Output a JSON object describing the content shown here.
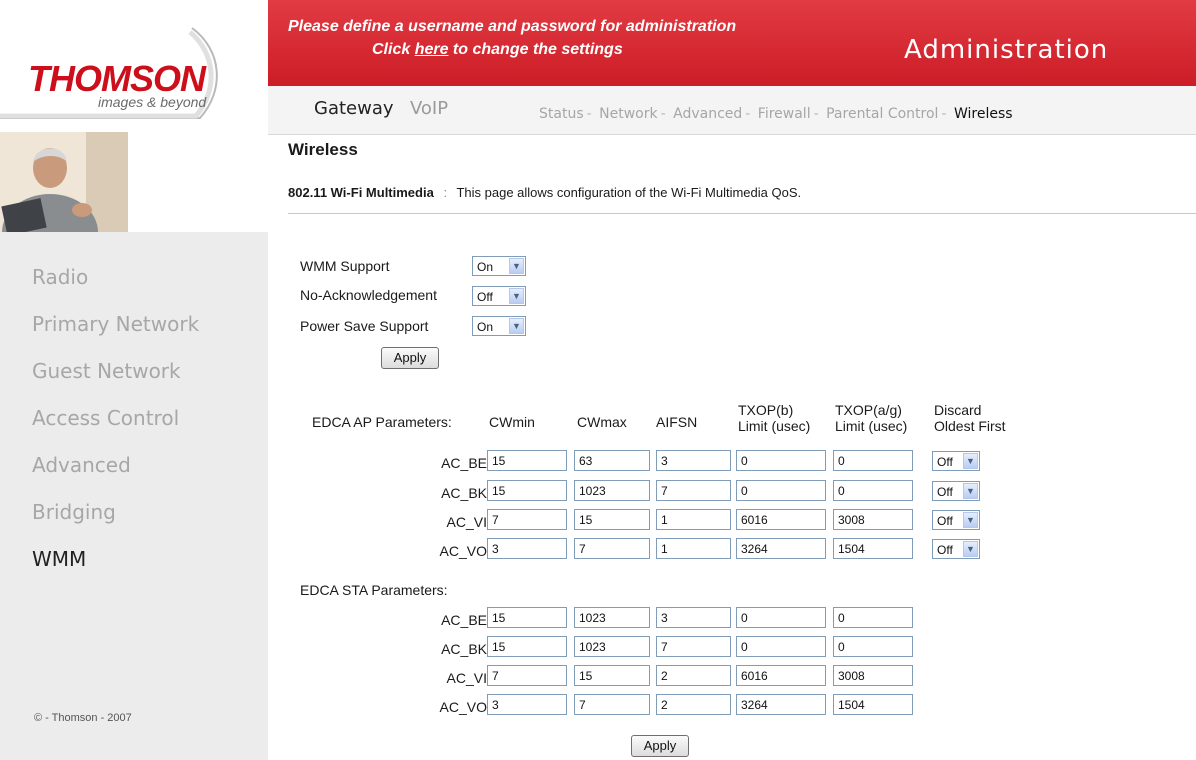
{
  "brand": {
    "logo": "THOMSON",
    "tagline": "images & beyond",
    "colors": {
      "red": "#cc1d27",
      "nav_inactive": "#a7a7a7"
    }
  },
  "banner": {
    "line1": "Please define a username and password for administration",
    "line2_prefix": "Click ",
    "line2_link": "here",
    "line2_suffix": " to change the settings",
    "title": "Administration"
  },
  "tabs": {
    "gateway": "Gateway",
    "voip": "VoIP"
  },
  "subnav": [
    "Status",
    "Network",
    "Advanced",
    "Firewall",
    "Parental Control",
    "Wireless"
  ],
  "sidebar": {
    "items": [
      "Radio",
      "Primary Network",
      "Guest Network",
      "Access Control",
      "Advanced",
      "Bridging",
      "WMM"
    ],
    "active": "WMM",
    "copyright": "© - Thomson - 2007"
  },
  "page": {
    "title": "Wireless",
    "intro_bold": "802.11 Wi-Fi Multimedia",
    "intro_sep": ":",
    "intro_text": "This page allows configuration of the Wi-Fi Multimedia QoS."
  },
  "settings": {
    "wmm_support": {
      "label": "WMM Support",
      "value": "On"
    },
    "no_ack": {
      "label": "No-Acknowledgement",
      "value": "Off"
    },
    "power_save": {
      "label": "Power Save Support",
      "value": "On"
    },
    "apply": "Apply"
  },
  "edca_ap": {
    "label": "EDCA AP Parameters:",
    "headers": {
      "cwmin": "CWmin",
      "cwmax": "CWmax",
      "aifsn": "AIFSN",
      "txop_b_1": "TXOP(b)",
      "txop_b_2": "Limit (usec)",
      "txop_ag_1": "TXOP(a/g)",
      "txop_ag_2": "Limit (usec)",
      "discard_1": "Discard",
      "discard_2": "Oldest First"
    },
    "rows": [
      {
        "name": "AC_BE",
        "cwmin": "15",
        "cwmax": "63",
        "aifsn": "3",
        "txop_b": "0",
        "txop_ag": "0",
        "discard": "Off"
      },
      {
        "name": "AC_BK",
        "cwmin": "15",
        "cwmax": "1023",
        "aifsn": "7",
        "txop_b": "0",
        "txop_ag": "0",
        "discard": "Off"
      },
      {
        "name": "AC_VI",
        "cwmin": "7",
        "cwmax": "15",
        "aifsn": "1",
        "txop_b": "6016",
        "txop_ag": "3008",
        "discard": "Off"
      },
      {
        "name": "AC_VO",
        "cwmin": "3",
        "cwmax": "7",
        "aifsn": "1",
        "txop_b": "3264",
        "txop_ag": "1504",
        "discard": "Off"
      }
    ]
  },
  "edca_sta": {
    "label": "EDCA STA Parameters:",
    "rows": [
      {
        "name": "AC_BE",
        "cwmin": "15",
        "cwmax": "1023",
        "aifsn": "3",
        "txop_b": "0",
        "txop_ag": "0"
      },
      {
        "name": "AC_BK",
        "cwmin": "15",
        "cwmax": "1023",
        "aifsn": "7",
        "txop_b": "0",
        "txop_ag": "0"
      },
      {
        "name": "AC_VI",
        "cwmin": "7",
        "cwmax": "15",
        "aifsn": "2",
        "txop_b": "6016",
        "txop_ag": "3008"
      },
      {
        "name": "AC_VO",
        "cwmin": "3",
        "cwmax": "7",
        "aifsn": "2",
        "txop_b": "3264",
        "txop_ag": "1504"
      }
    ],
    "apply": "Apply"
  }
}
